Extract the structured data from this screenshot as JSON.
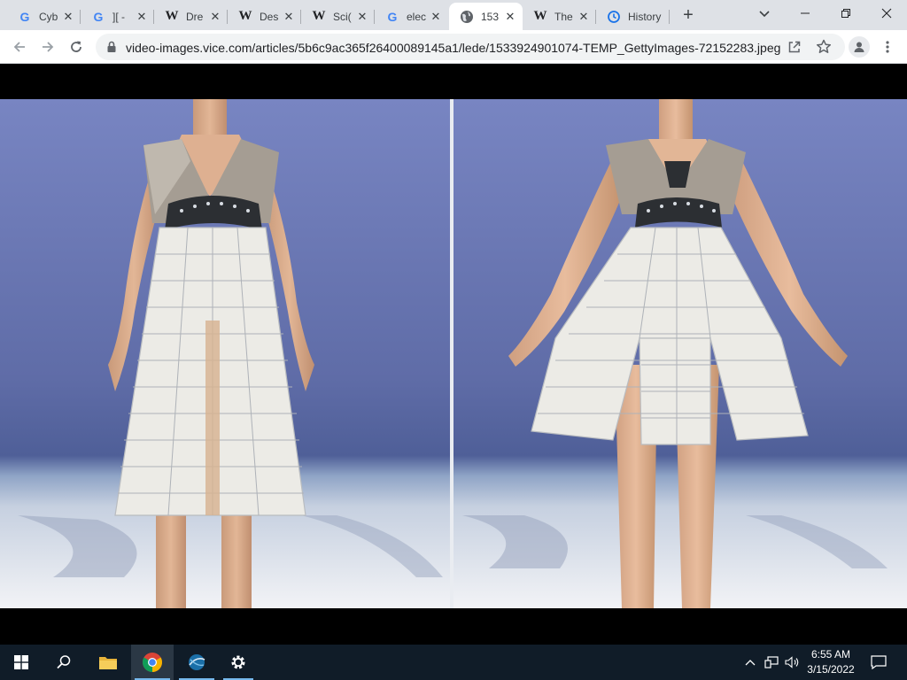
{
  "browser": {
    "tabs": [
      {
        "favicon": "google-icon",
        "title": "Cyb",
        "active": false
      },
      {
        "favicon": "google-icon",
        "title": "][ -",
        "active": false
      },
      {
        "favicon": "wikipedia-icon",
        "title": "Dre",
        "active": false
      },
      {
        "favicon": "wikipedia-icon",
        "title": "Des",
        "active": false
      },
      {
        "favicon": "wikipedia-icon",
        "title": "Sci(",
        "active": false
      },
      {
        "favicon": "google-icon",
        "title": "elec",
        "active": false
      },
      {
        "favicon": "globe-icon",
        "title": "153",
        "active": true
      },
      {
        "favicon": "wikipedia-icon",
        "title": "The",
        "active": false
      },
      {
        "favicon": "history-icon",
        "title": "History",
        "active": false
      }
    ],
    "address_bar": {
      "url": "video-images.vice.com/articles/5b6c9ac365f26400089145a1/lede/1533924901074-TEMP_GettyImages-72152283.jpeg..."
    }
  },
  "page": {
    "content_icon": "photo-of-two-runway-models-in-white-paneled-dresses",
    "colors": {
      "backdrop": "#6b78b6",
      "floor": "#dfe3ec",
      "dress_panels": "#ecebe6",
      "dress_top": "#a59d93",
      "belt": "#2c2f33"
    }
  },
  "taskbar": {
    "apps": [
      "windows-start-icon",
      "search-icon",
      "file-explorer-icon",
      "chrome-icon",
      "network-app-icon",
      "settings-icon"
    ],
    "time": "6:55 AM",
    "date": "3/15/2022"
  }
}
